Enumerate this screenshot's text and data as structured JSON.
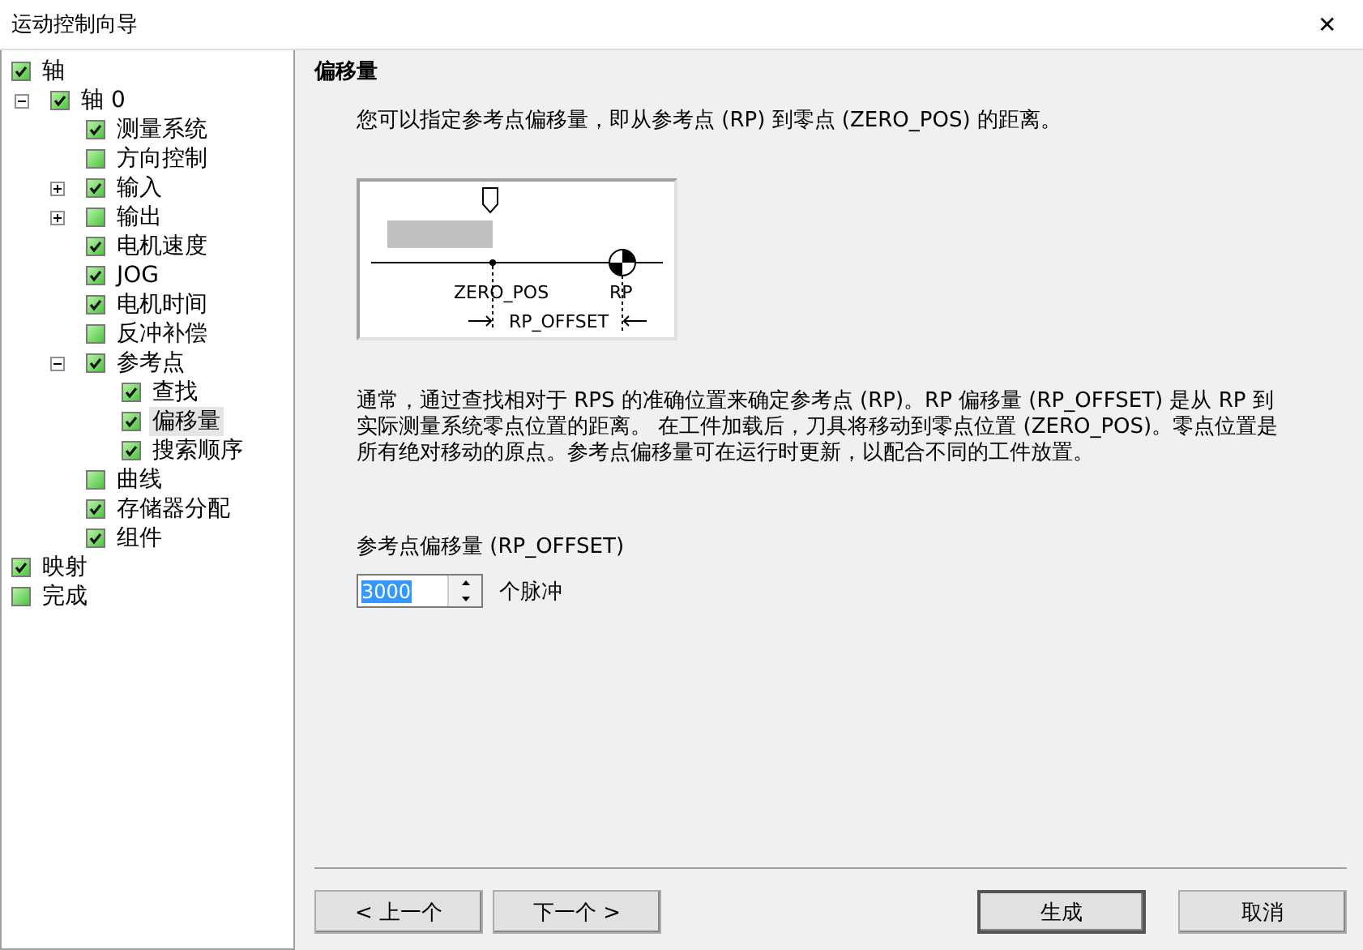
{
  "window": {
    "title": "运动控制向导",
    "close": "✕"
  },
  "tree": [
    {
      "label": "轴",
      "checked": true,
      "selected": false,
      "children": [
        {
          "label": "轴 0",
          "checked": true,
          "selected": false,
          "expanded": true,
          "children": [
            {
              "label": "测量系统",
              "checked": true,
              "selected": false
            },
            {
              "label": "方向控制",
              "checked": false,
              "selected": false
            },
            {
              "label": "输入",
              "checked": true,
              "selected": false,
              "expanded": false
            },
            {
              "label": "输出",
              "checked": false,
              "selected": false,
              "expanded": false
            },
            {
              "label": "电机速度",
              "checked": true,
              "selected": false
            },
            {
              "label": "JOG",
              "checked": true,
              "selected": false
            },
            {
              "label": "电机时间",
              "checked": true,
              "selected": false
            },
            {
              "label": "反冲补偿",
              "checked": false,
              "selected": false
            },
            {
              "label": "参考点",
              "checked": true,
              "selected": false,
              "expanded": true,
              "children": [
                {
                  "label": "查找",
                  "checked": true,
                  "selected": false
                },
                {
                  "label": "偏移量",
                  "checked": true,
                  "selected": true
                },
                {
                  "label": "搜索顺序",
                  "checked": true,
                  "selected": false
                }
              ]
            },
            {
              "label": "曲线",
              "checked": false,
              "selected": false
            },
            {
              "label": "存储器分配",
              "checked": true,
              "selected": false
            },
            {
              "label": "组件",
              "checked": true,
              "selected": false
            }
          ]
        }
      ]
    },
    {
      "label": "映射",
      "checked": true,
      "selected": false
    },
    {
      "label": "完成",
      "checked": false,
      "selected": false
    }
  ],
  "page": {
    "heading": "偏移量",
    "intro": "您可以指定参考点偏移量，即从参考点 (RP) 到零点 (ZERO_POS) 的距离。",
    "diagram": {
      "zero_label": "ZERO_POS",
      "rp_label": "RP",
      "offset_label": "RP_OFFSET"
    },
    "description": "通常，通过查找相对于 RPS 的准确位置来确定参考点 (RP)。RP 偏移量 (RP_OFFSET) 是从 RP 到实际测量系统零点位置的距离。 在工件加载后，刀具将移动到零点位置 (ZERO_POS)。零点位置是所有绝对移动的原点。参考点偏移量可在运行时更新，以配合不同的工件放置。",
    "field": {
      "label": "参考点偏移量 (RP_OFFSET)",
      "value": "3000",
      "value_selected": true,
      "unit": "个脉冲"
    }
  },
  "buttons": [
    {
      "label": "< 上一个",
      "default": false
    },
    {
      "label": "下一个 >",
      "default": false
    },
    {
      "label": "生成",
      "default": true
    },
    {
      "label": "取消",
      "default": false
    }
  ]
}
